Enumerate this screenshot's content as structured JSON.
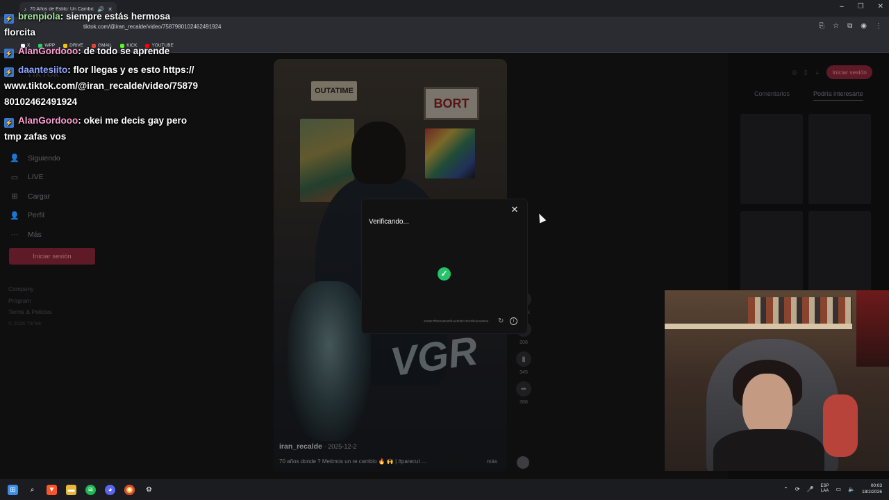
{
  "browser": {
    "tab_title": "70 Años de Estilo: Un Cambio",
    "url": "tiktok.com/@iran_recalde/video/7587980102462491924",
    "bookmarks": [
      {
        "label": "X",
        "icon": "x-icon",
        "color": "#ffffff"
      },
      {
        "label": "WPP",
        "icon": "whatsapp-icon",
        "color": "#25d366"
      },
      {
        "label": "DRIVE",
        "icon": "drive-icon",
        "color": "#f4c20d"
      },
      {
        "label": "GMAIL",
        "icon": "gmail-icon",
        "color": "#ea4335"
      },
      {
        "label": "KICK",
        "icon": "kick-icon",
        "color": "#53fc18"
      },
      {
        "label": "YOUTUBE",
        "icon": "youtube-icon",
        "color": "#ff0000"
      }
    ]
  },
  "tiktok": {
    "logo": "TikTok",
    "nav": [
      {
        "label": "Siguiendo",
        "icon": "person-icon"
      },
      {
        "label": "LIVE",
        "icon": "live-icon"
      },
      {
        "label": "Cargar",
        "icon": "upload-icon"
      },
      {
        "label": "Perfil",
        "icon": "profile-icon"
      },
      {
        "label": "Más",
        "icon": "more-icon"
      }
    ],
    "login_label": "Iniciar sesión",
    "footer": [
      "Company",
      "Program",
      "Terms & Policies"
    ],
    "copyright": "© 2026 TikTok",
    "video": {
      "author": "iran_recalde",
      "date": "· 2025-12-2",
      "caption": "70 años donde ? Metimos un re cambio 🔥 🙌 | #parecut ...",
      "more": "más",
      "posters": [
        "OUTATIME",
        "BORT"
      ],
      "graffiti": "VGR"
    },
    "actions": [
      {
        "icon": "heart-icon",
        "count": "15.6K"
      },
      {
        "icon": "comment-icon",
        "count": "208"
      },
      {
        "icon": "bookmark-icon",
        "count": "345"
      },
      {
        "icon": "share-icon",
        "count": "368"
      }
    ],
    "right_panel": {
      "login_label": "Iniciar sesión",
      "tabs": [
        "Comentarios",
        "Podría interesarte"
      ]
    }
  },
  "captcha": {
    "title": "Verificando...",
    "code": "2606b7ff993a9049fd1ad03bc1f0c3f0de0a9b0d",
    "status": "verified"
  },
  "chat": [
    {
      "user": "brenpiola",
      "text": ": siempre estás hermosa florcita",
      "color": "#a5e79b"
    },
    {
      "user": "AlanGordooo",
      "text": ": de todo se aprende",
      "color": "#ff9fd3"
    },
    {
      "user": "daantesiito",
      "text": ": flor llegas y es esto https://www.tiktok.com/@iran_recalde/video/7587980102462491924",
      "color": "#8fa3ff"
    },
    {
      "user": "AlanGordooo",
      "text": ": okei me decis gay pero tmp zafas vos",
      "color": "#ff9fd3"
    }
  ],
  "taskbar": {
    "lang": "ESP",
    "lang2": "LAA",
    "time": "00:03",
    "date": "18/2/2026",
    "apps": [
      "windows-start-icon",
      "search-icon",
      "brave-icon",
      "explorer-icon",
      "spotify-icon",
      "discord-icon",
      "chrome-icon",
      "settings-icon"
    ]
  }
}
